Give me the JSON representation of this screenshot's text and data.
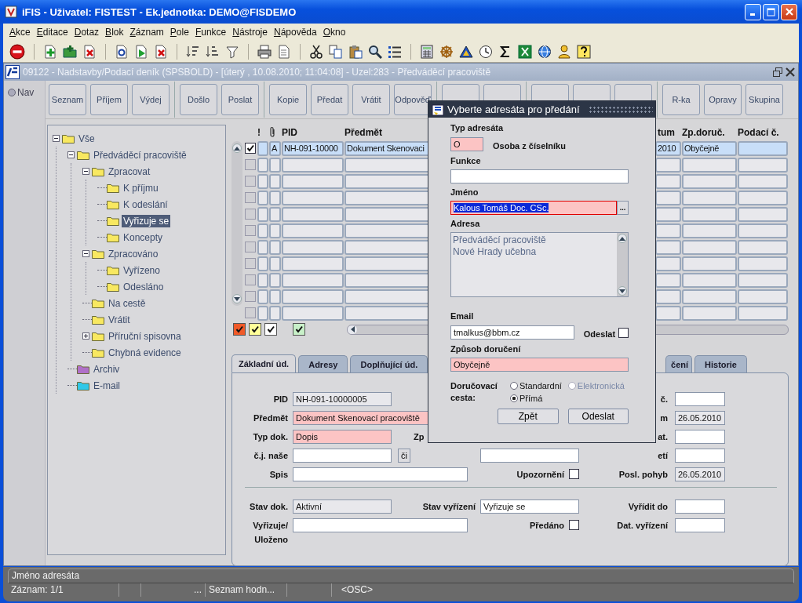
{
  "window": {
    "title": "iFIS - Uživatel: FISTEST - Ek.jednotka: DEMO@FISDEMO"
  },
  "menu": [
    "Akce",
    "Editace",
    "Dotaz",
    "Blok",
    "Záznam",
    "Pole",
    "Funkce",
    "Nástroje",
    "Nápověda",
    "Okno"
  ],
  "form_window": {
    "title": "09122 - Nadstavby/Podací deník (SPSBOLD) - [úterý  , 10.08.2010; 11:04:08] - Uzel:283 - Předváděcí pracoviště"
  },
  "nav": {
    "label": "Nav",
    "selected": false
  },
  "button_groups": [
    [
      "Seznam",
      "Příjem",
      "Výdej"
    ],
    [
      "Došlo",
      "Poslat"
    ],
    [
      "Kopie",
      "Předat",
      "Vrátit",
      "Odpověď"
    ],
    [
      "R-ka",
      "Opravy",
      "Skupina"
    ]
  ],
  "tree": [
    {
      "label": "Vše",
      "color": "#f8e860",
      "selected": false,
      "expandable": true,
      "expanded": true,
      "children": [
        {
          "label": "Předváděcí pracoviště",
          "color": "#f8e860",
          "selected": false,
          "expandable": true,
          "expanded": true,
          "children": [
            {
              "label": "Zpracovat",
              "color": "#f8e860",
              "selected": false,
              "expandable": true,
              "expanded": true,
              "children": [
                {
                  "label": "K příjmu",
                  "color": "#f8e860",
                  "selected": false,
                  "expandable": false
                },
                {
                  "label": "K odeslání",
                  "color": "#f8e860",
                  "selected": false,
                  "expandable": false
                },
                {
                  "label": "Vyřizuje se",
                  "color": "#f8e860",
                  "selected": true,
                  "expandable": false
                },
                {
                  "label": "Koncepty",
                  "color": "#f8e860",
                  "selected": false,
                  "expandable": false
                }
              ]
            },
            {
              "label": "Zpracováno",
              "color": "#f8e860",
              "selected": false,
              "expandable": true,
              "expanded": true,
              "children": [
                {
                  "label": "Vyřízeno",
                  "color": "#f8e860",
                  "selected": false,
                  "expandable": false
                },
                {
                  "label": "Odesláno",
                  "color": "#f8e860",
                  "selected": false,
                  "expandable": false
                }
              ]
            },
            {
              "label": "Na cestě",
              "color": "#f8e860",
              "selected": false,
              "expandable": false
            },
            {
              "label": "Vrátit",
              "color": "#f8e860",
              "selected": false,
              "expandable": false
            },
            {
              "label": "Příruční spisovna",
              "color": "#f8e860",
              "selected": false,
              "expandable": true,
              "expanded": false
            },
            {
              "label": "Chybná evidence",
              "color": "#f8e860",
              "selected": false,
              "expandable": false
            }
          ]
        },
        {
          "label": "Archiv",
          "color": "#b070c8",
          "selected": false,
          "expandable": false
        },
        {
          "label": "E-mail",
          "color": "#30c8e8",
          "selected": false,
          "expandable": false
        }
      ]
    }
  ],
  "grid": {
    "columns": [
      {
        "kind": "text",
        "label": "!"
      },
      {
        "kind": "attachment"
      },
      {
        "kind": "text",
        "label": "PID"
      },
      {
        "kind": "text",
        "label": "Předmět"
      },
      {
        "kind": "text",
        "label": "tum"
      },
      {
        "kind": "text",
        "label": "Zp.doruč."
      },
      {
        "kind": "text",
        "label": "Podací č."
      }
    ],
    "rows": [
      {
        "checked": true,
        "selected": true,
        "cells": [
          "A",
          "NH-091-10000",
          "Dokument Skenovaci",
          "2010",
          "Obyčejně"
        ]
      },
      {
        "checked": false,
        "selected": false
      },
      {
        "checked": false,
        "selected": false
      },
      {
        "checked": false,
        "selected": false
      },
      {
        "checked": false,
        "selected": false
      },
      {
        "checked": false,
        "selected": false
      },
      {
        "checked": false,
        "selected": false
      },
      {
        "checked": false,
        "selected": false
      },
      {
        "checked": false,
        "selected": false
      },
      {
        "checked": false,
        "selected": false
      },
      {
        "checked": false,
        "selected": false
      }
    ]
  },
  "filter_checks": [
    {
      "color": "#f05a28",
      "checked": true
    },
    {
      "color": "#ffff99",
      "checked": true
    },
    {
      "color": "#ffffff",
      "checked": true
    },
    {
      "color": "#c8f0c8",
      "checked": true
    }
  ],
  "tabs": [
    {
      "label": "Základní úd.",
      "selected": true
    },
    {
      "label": "Adresy",
      "selected": false
    },
    {
      "label": "Doplňující úd.",
      "selected": false
    },
    {
      "label": "čení",
      "selected": false,
      "cut": true
    },
    {
      "label": "Historie",
      "selected": false
    }
  ],
  "form": {
    "rows": [
      {
        "left": {
          "label": "PID",
          "value": "NH-091-10000005",
          "kind": "readonly",
          "wide": false
        },
        "right": {
          "label": "č.",
          "kind": "text"
        }
      },
      {
        "left": {
          "label": "Předmět",
          "value": "Dokument Skenovací pracoviště",
          "kind": "required",
          "wide": true
        },
        "right": {
          "label": "m",
          "value": "26.05.2010",
          "kind": "readonly"
        }
      },
      {
        "left": {
          "label": "Typ dok.",
          "value": "Dopis",
          "kind": "required",
          "wide": false
        },
        "middle": {
          "label": "Zp",
          "kind": "cut"
        },
        "right": {
          "label": "at.",
          "kind": "text"
        }
      },
      {
        "left": {
          "label": "č.j. naše",
          "kind": "text",
          "wide": false,
          "button": "či"
        },
        "middle": {
          "kind": "text"
        },
        "right": {
          "label": "etí",
          "kind": "text"
        }
      },
      {
        "left": {
          "label": "Spis",
          "kind": "text",
          "wide": true
        },
        "middle": {
          "label": "Upozornění",
          "kind": "checkbox",
          "checked": false
        },
        "right": {
          "label": "Posl. pohyb",
          "value": "26.05.2010",
          "kind": "readonly"
        }
      }
    ],
    "rows2": [
      {
        "left": {
          "label": "Stav dok.",
          "value": "Aktivní",
          "kind": "readonly",
          "wide": false
        },
        "middle": {
          "label": "Stav vyřízení",
          "value": "Vyřizuje se",
          "kind": "text"
        },
        "right": {
          "label": "Vyřídit do",
          "kind": "text"
        }
      },
      {
        "left": {
          "label": "Vyřizuje/ Uloženo",
          "kind": "text",
          "wide": true
        },
        "middle": {
          "label": "Předáno",
          "kind": "checkbox",
          "checked": false
        },
        "right": {
          "label": "Dat. vyřízení",
          "kind": "text"
        }
      }
    ]
  },
  "dialog": {
    "title": "Vyberte adresáta pro předání",
    "type_label": "Typ adresáta",
    "type_value": "O",
    "type_name": "Osoba z číselníku",
    "function_label": "Funkce",
    "name_label": "Jméno",
    "name_value": "Kalous Tomáš Doc. CSc.",
    "name_selected": true,
    "lov_button": "...",
    "address_label": "Adresa",
    "address_lines": [
      "Předváděcí pracoviště",
      "Nové Hrady učebna"
    ],
    "email_label": "Email",
    "email_value": "tmalkus@bbm.cz",
    "send_label": "Odeslat",
    "send_checked": false,
    "delivery_label": "Způsob doručení",
    "delivery_value": "Obyčejně",
    "route_label": "Doručovací cesta:",
    "routes": [
      {
        "label": "Standardní",
        "selected": false,
        "disabled": false
      },
      {
        "label": "Elektronická",
        "selected": false,
        "disabled": true
      },
      {
        "label": "Přímá",
        "selected": true,
        "disabled": false
      }
    ],
    "buttons": [
      "Zpět",
      "Odeslat"
    ]
  },
  "status": {
    "message": "Jméno adresáta",
    "record": "Záznam: 1/1",
    "ellipsis": "...",
    "list_hint": "Seznam hodn...",
    "mode": "<OSC>"
  }
}
